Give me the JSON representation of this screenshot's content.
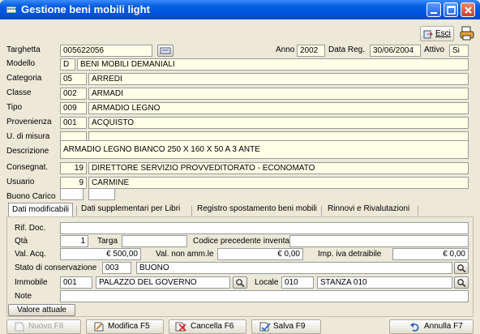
{
  "window": {
    "title": "Gestione beni mobili light",
    "icon_text": "===="
  },
  "toolbar": {
    "esci_label": "Esci"
  },
  "header": {
    "targhetta_label": "Targhetta",
    "targhetta_value": "005622056",
    "anno_label": "Anno",
    "anno_value": "2002",
    "data_reg_label": "Data Reg.",
    "data_reg_value": "30/06/2004",
    "attivo_label": "Attivo",
    "attivo_value": "Si"
  },
  "form": {
    "modello": {
      "label": "Modello",
      "code": "D",
      "desc": "BENI MOBILI DEMANIALI"
    },
    "categoria": {
      "label": "Categoria",
      "code": "05",
      "desc": "ARREDI"
    },
    "classe": {
      "label": "Classe",
      "code": "002",
      "desc": "ARMADI"
    },
    "tipo": {
      "label": "Tipo",
      "code": "009",
      "desc": "ARMADIO LEGNO"
    },
    "provenienza": {
      "label": "Provenienza",
      "code": "001",
      "desc": "ACQUISTO"
    },
    "unita": {
      "label": "U. di misura",
      "code": "",
      "desc": ""
    },
    "descrizione": {
      "label": "Descrizione",
      "value": "ARMADIO LEGNO  BIANCO 250 X 160 X 50 A 3 ANTE"
    },
    "consegnat": {
      "label": "Consegnat.",
      "code": "19",
      "desc": "DIRETTORE SERVIZIO PROVVEDITORATO - ECONOMATO"
    },
    "usuario": {
      "label": "Usuario",
      "code": "9",
      "desc": "CARMINE"
    },
    "buono": {
      "label": "Buono Carico",
      "v1": "",
      "v2": ""
    }
  },
  "tabs": [
    {
      "label": "Dati modificabili",
      "active": true
    },
    {
      "label": "Dati supplementari per Libri",
      "active": false
    },
    {
      "label": "Registro spostamento beni mobili",
      "active": false
    },
    {
      "label": "Rinnovi e Rivalutazioni",
      "active": false
    }
  ],
  "panel": {
    "rif_doc_label": "Rif. Doc.",
    "rif_doc_value": "",
    "qta_label": "Qtà",
    "qta_value": "1",
    "targa_label": "Targa",
    "targa_value": "",
    "codice_prec_label": "Codice precedente inventario",
    "codice_prec_value": "",
    "val_acq_label": "Val. Acq.",
    "val_acq_value": "€ 500,00",
    "val_non_label": "Val. non amm.le",
    "val_non_value": "€ 0,00",
    "imp_iva_label": "Imp. iva detraibile",
    "imp_iva_value": "€ 0,00",
    "stato_label": "Stato di conservazione",
    "stato_code": "003",
    "stato_desc": "BUONO",
    "immobile_label": "Immobile",
    "immobile_code": "001",
    "immobile_desc": "PALAZZO DEL GOVERNO",
    "locale_label": "Locale",
    "locale_code": "010",
    "locale_desc": "STANZA 010",
    "note_label": "Note",
    "note_value": "",
    "valore_attuale_label": "Valore attuale"
  },
  "bottom": {
    "nuovo": "Nuovo  F8",
    "modifica": "Modifica  F5",
    "cancella": "Cancella  F6",
    "salva": "Salva  F9",
    "annulla": "Annulla  F7"
  },
  "colors": {
    "titlebar": "#0054E3",
    "field_bg": "#FFFFE8",
    "window_bg": "#ECE9D8"
  }
}
